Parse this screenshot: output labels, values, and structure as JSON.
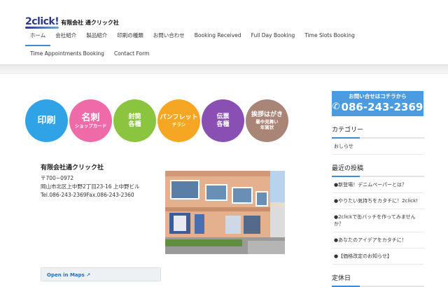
{
  "header": {
    "logo_mark": "2click!",
    "logo_text": "有限会社 通クリック社"
  },
  "nav": {
    "items": [
      {
        "label": "ホーム",
        "active": true
      },
      {
        "label": "会社紹介"
      },
      {
        "label": "製品紹介"
      },
      {
        "label": "印刷の種類"
      },
      {
        "label": "お問い合わせ"
      },
      {
        "label": "Booking Received"
      },
      {
        "label": "Full Day Booking"
      },
      {
        "label": "Time Slots Booking"
      },
      {
        "label": "Time Appointments Booking"
      },
      {
        "label": "Contact Form"
      }
    ]
  },
  "circles": [
    {
      "main": "印刷",
      "sub": "",
      "color": "#2fa3e6"
    },
    {
      "main": "名刺",
      "sub": "ショップカード",
      "color": "#ef6aa8"
    },
    {
      "main": "封筒\n各種",
      "sub": "",
      "color": "#8bc43f"
    },
    {
      "main": "パンフレット",
      "sub": "チラシ",
      "color": "#f5a623"
    },
    {
      "main": "伝票\n各種",
      "sub": "",
      "color": "#8a4fb3"
    },
    {
      "main": "挨拶はがき",
      "sub": "暑中見舞い\n年賀状",
      "color": "#a98578"
    }
  ],
  "company": {
    "name": "有限会社通クリック社",
    "zip": "〒700−0972",
    "address": "岡山市北区上中野2丁目23-16 上中野ビル",
    "tel": "Tel.086-243-2369Fax.086-243-2360"
  },
  "map": {
    "link": "Open in Maps"
  },
  "sidebar": {
    "contact_top": "お問い合せはコチラから",
    "contact_phone": "086-243-2369",
    "category_title": "カテゴリー",
    "categories": [
      "おしらせ"
    ],
    "recent_title": "最近の投稿",
    "recent_posts": [
      "●新登場！デニムペーパーとは？",
      "●やりたい気持ちをカタチに！2click!",
      "●2clickで缶バッチを作ってみませんか？",
      "●あなたのアイデアをカタチに！",
      "●【価格改定のお知らせ】"
    ],
    "holiday_title": "定休日"
  }
}
